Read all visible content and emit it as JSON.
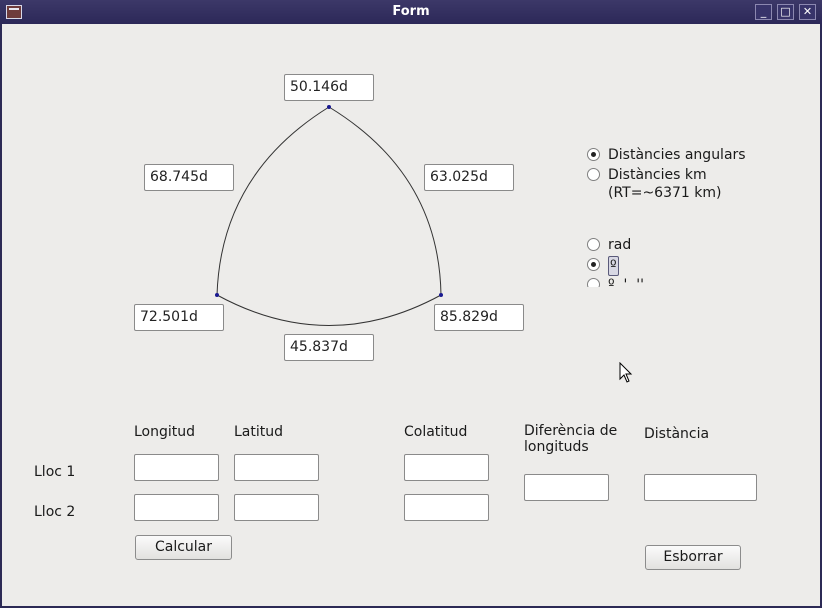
{
  "window": {
    "title": "Form"
  },
  "triangle": {
    "top_value": "50.146d",
    "left_side_value": "68.745d",
    "right_side_value": "63.025d",
    "bottom_left_value": "72.501d",
    "bottom_right_value": "85.829d",
    "bottom_side_value": "45.837d"
  },
  "distance_mode": {
    "options": [
      {
        "label": "Distàncies angulars",
        "checked": true
      },
      {
        "label": "Distàncies km",
        "label_line2": "(RT=~6371 km)",
        "checked": false
      }
    ]
  },
  "angle_unit": {
    "options": [
      {
        "label": "rad",
        "checked": false
      },
      {
        "label": "º",
        "checked": true
      },
      {
        "label": "º  '  ''",
        "checked": false
      }
    ]
  },
  "form": {
    "col_longitud": "Longitud",
    "col_latitud": "Latitud",
    "col_colatitud": "Colatitud",
    "col_diferencia": "Diferència de longituds",
    "col_distancia": "Distància",
    "row_lloc1": "Lloc 1",
    "row_lloc2": "Lloc 2",
    "calcular_label": "Calcular",
    "esborrar_label": "Esborrar",
    "lloc1_longitud": "",
    "lloc1_latitud": "",
    "lloc1_colatitud": "",
    "lloc2_longitud": "",
    "lloc2_latitud": "",
    "lloc2_colatitud": "",
    "diferencia_value": "",
    "distancia_value": ""
  }
}
